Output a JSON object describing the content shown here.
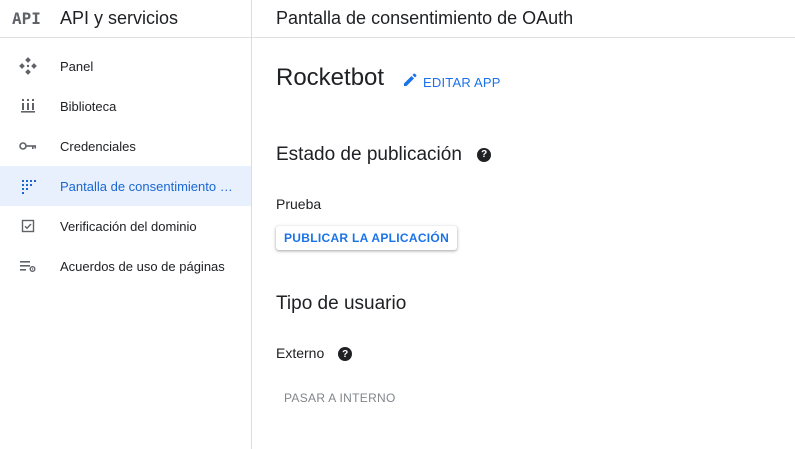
{
  "sidebar": {
    "logo": "API",
    "app_name": "API y servicios",
    "items": [
      {
        "label": "Panel",
        "icon": "dashboard-icon"
      },
      {
        "label": "Biblioteca",
        "icon": "library-icon"
      },
      {
        "label": "Credenciales",
        "icon": "key-icon"
      },
      {
        "label": "Pantalla de consentimiento …",
        "icon": "consent-screen-icon",
        "active": true
      },
      {
        "label": "Verificación del dominio",
        "icon": "domain-verification-icon"
      },
      {
        "label": "Acuerdos de uso de páginas",
        "icon": "page-usage-settings-icon"
      }
    ]
  },
  "header": {
    "title": "Pantalla de consentimiento de OAuth"
  },
  "main": {
    "app_name": "Rocketbot",
    "edit_label": "EDITAR APP",
    "publishing": {
      "title": "Estado de publicación",
      "status": "Prueba",
      "publish_label": "PUBLICAR LA APLICACIÓN"
    },
    "user_type": {
      "title": "Tipo de usuario",
      "value": "Externo",
      "switch_label": "PASAR A INTERNO"
    }
  },
  "colors": {
    "accent": "#1a73e8",
    "active_bg": "#e8f0fe",
    "active_text": "#1967d2"
  }
}
